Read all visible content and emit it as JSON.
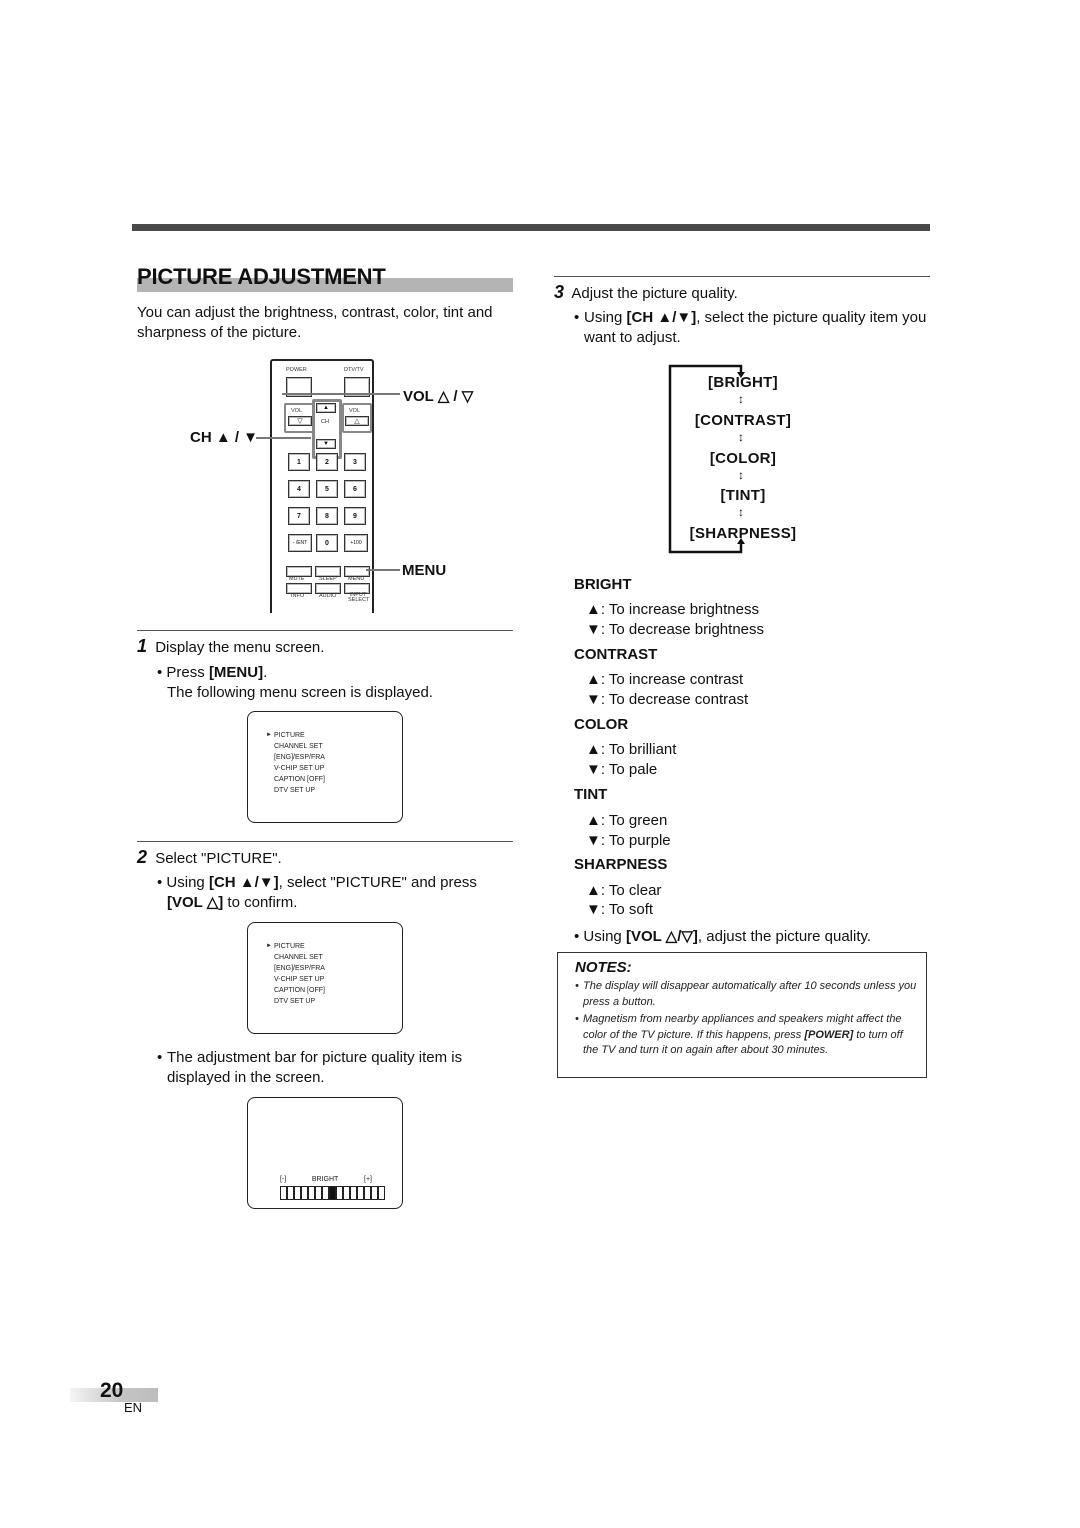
{
  "section": {
    "title": "PICTURE ADJUSTMENT",
    "intro": "You can adjust the brightness, contrast, color, tint and sharpness of the picture."
  },
  "remote": {
    "top_labels": [
      "POWER",
      "DTV/TV"
    ],
    "vol_left_label": "VOL",
    "vol_right_label": "VOL",
    "ch_label": "CH",
    "keypad": [
      "1",
      "2",
      "3",
      "4",
      "5",
      "6",
      "7",
      "8",
      "9",
      "- /ENT",
      "0",
      "+100"
    ],
    "row1_labels": [
      "MUTE",
      "SLEEP",
      "MENU"
    ],
    "row2_labels": [
      "INFO",
      "AUDIO",
      "INPUT SELECT"
    ],
    "callouts": {
      "vol": "VOL △ / ▽",
      "ch": "CH ▲ / ▼",
      "menu": "MENU"
    }
  },
  "steps": [
    {
      "number": "1",
      "heading": "Display the menu screen.",
      "bullet_prefix": "Press ",
      "bullet_key": "[MENU]",
      "bullet_suffix": ".",
      "follow": "The following menu screen is displayed."
    },
    {
      "number": "2",
      "heading": "Select \"PICTURE\".",
      "bullet_prefix": "Using ",
      "bullet_key": "[CH ▲/▼]",
      "bullet_mid": ", select \"PICTURE\" and press",
      "bullet_key2": "[VOL △]",
      "bullet_suffix": " to confirm.",
      "follow": "The adjustment bar for picture quality item is displayed in the screen."
    },
    {
      "number": "3",
      "heading": "Adjust the picture quality.",
      "bullet_prefix": "Using ",
      "bullet_key": "[CH ▲/▼]",
      "bullet_suffix": ", select the picture quality item you want to adjust.",
      "final_prefix": "Using ",
      "final_key": "[VOL △/▽]",
      "final_suffix": ", adjust the picture quality."
    }
  ],
  "tv_menu": {
    "cursor": "►",
    "items": [
      "PICTURE",
      "CHANNEL SET",
      "[ENG]/ESP/FRA",
      "V-CHIP SET UP",
      "CAPTION [OFF]",
      "DTV SET UP"
    ]
  },
  "adjust_screen": {
    "minus": "[-]",
    "label": "BRIGHT",
    "plus": "[+]",
    "segments": 15,
    "active_segment": 8
  },
  "flow": [
    "[BRIGHT]",
    "[CONTRAST]",
    "[COLOR]",
    "[TINT]",
    "[SHARPNESS]"
  ],
  "settings": [
    {
      "name": "BRIGHT",
      "up": "▲: To increase brightness",
      "down": "▼: To decrease brightness"
    },
    {
      "name": "CONTRAST",
      "up": "▲: To increase contrast",
      "down": "▼: To decrease contrast"
    },
    {
      "name": "COLOR",
      "up": "▲: To brilliant",
      "down": "▼: To pale"
    },
    {
      "name": "TINT",
      "up": "▲: To green",
      "down": "▼: To purple"
    },
    {
      "name": "SHARPNESS",
      "up": "▲: To clear",
      "down": "▼: To soft"
    }
  ],
  "notes": {
    "title": "NOTES:",
    "items": [
      {
        "text": "The display will disappear automatically after 10 seconds unless you press a button."
      },
      {
        "key": "[POWER]",
        "before": "Magnetism from nearby appliances and speakers might affect the color of the TV picture. If this happens, press ",
        "after": " to turn off the TV and turn it on again after about 30 minutes."
      }
    ]
  },
  "footer": {
    "page_number": "20",
    "language": "EN"
  }
}
